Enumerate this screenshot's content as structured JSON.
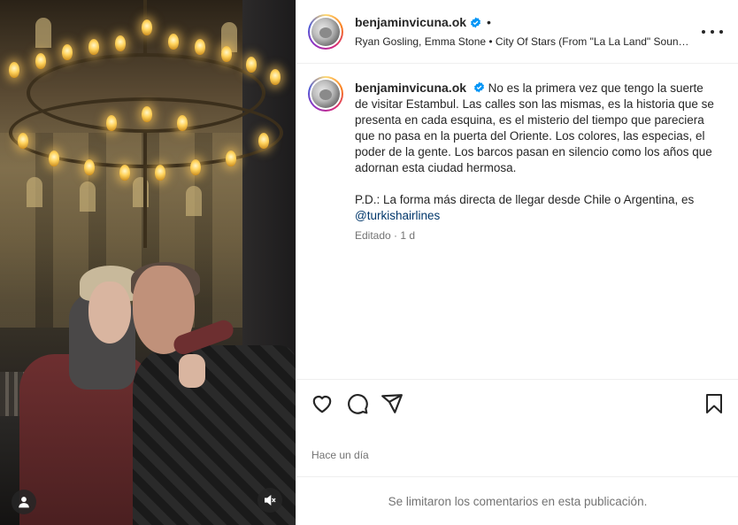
{
  "post": {
    "username": "benjaminvicuna.ok",
    "separator": "•",
    "song": "Ryan Gosling, Emma Stone • City Of Stars (From \"La La Land\" Soundtrack)",
    "caption_p1": "No es la primera vez que tengo la suerte de visitar Estambul. Las calles son las mismas, es la historia que se presenta en cada esquina, es el misterio del tiempo que pareciera que no pasa en la puerta del Oriente. Los colores, las especias, el poder de la gente. Los barcos pasan en silencio como los años que adornan esta ciudad hermosa.",
    "caption_p2": "P.D.: La forma más directa de llegar desde Chile o Argentina, es",
    "mention": "@turkishairlines",
    "edited_meta": "Editado · 1 d",
    "time_ago": "Hace un día",
    "comments_disabled": "Se limitaron los comentarios en esta publicación."
  },
  "colors": {
    "verified": "#0095f6",
    "mention": "#00376b",
    "muted_text": "#737373",
    "divider": "#efefef"
  },
  "icons": {
    "verified": "verified-badge-icon",
    "more": "more-options-icon",
    "like": "heart-icon",
    "comment": "comment-bubble-icon",
    "share": "paper-plane-icon",
    "save": "bookmark-icon",
    "tag": "user-tag-icon",
    "audio": "audio-muted-icon"
  }
}
